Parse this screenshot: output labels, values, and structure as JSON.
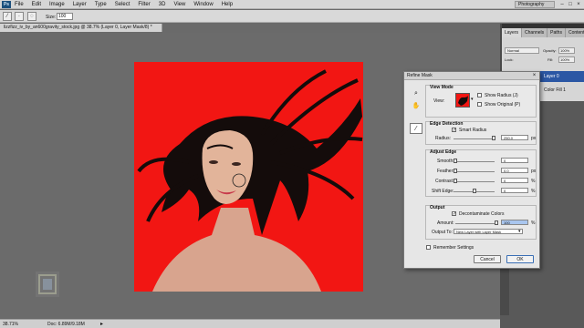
{
  "menubar": {
    "logo": "Ps",
    "items": [
      "File",
      "Edit",
      "Image",
      "Layer",
      "Type",
      "Select",
      "Filter",
      "3D",
      "View",
      "Window",
      "Help"
    ],
    "workspace": "Photography"
  },
  "options": {
    "size_label": "Size:",
    "size_value": "100"
  },
  "document": {
    "tab_title": "lizzfizz_iv_by_an600gravity_stock.jpg @ 38.7% (Layer 0, Layer Mask/8) *"
  },
  "status": {
    "zoom": "38.71%",
    "doc": "Doc: 6.89M/9.18M"
  },
  "panels": {
    "tabs": [
      "Layers",
      "Channels",
      "Paths",
      "Contents"
    ],
    "blend_mode": "Normal",
    "opacity_label": "Opacity:",
    "opacity_value": "100%",
    "lock_label": "Lock:",
    "fill_label": "Fill:",
    "fill_value": "100%",
    "layers": [
      {
        "name": "Layer 0"
      },
      {
        "name": "Color Fill 1"
      }
    ]
  },
  "dialog": {
    "title": "Refine Mask",
    "view_mode": {
      "title": "View Mode",
      "view_label": "View:",
      "show_radius": "Show Radius (J)",
      "show_original": "Show Original (P)"
    },
    "edge_detection": {
      "title": "Edge Detection",
      "smart_radius": "Smart Radius",
      "radius_label": "Radius:",
      "radius_value": "250.0",
      "radius_unit": "px"
    },
    "adjust_edge": {
      "title": "Adjust Edge",
      "smooth_label": "Smooth:",
      "smooth_value": "0",
      "feather_label": "Feather:",
      "feather_value": "0.0",
      "feather_unit": "px",
      "contrast_label": "Contrast:",
      "contrast_value": "0",
      "contrast_unit": "%",
      "shift_label": "Shift Edge:",
      "shift_value": "0",
      "shift_unit": "%"
    },
    "output": {
      "title": "Output",
      "decontaminate": "Decontaminate Colors",
      "amount_label": "Amount:",
      "amount_value": "100",
      "amount_unit": "%",
      "output_to_label": "Output To:",
      "output_to_value": "New Layer with Layer Mask"
    },
    "remember": "Remember Settings",
    "cancel": "Cancel",
    "ok": "OK"
  }
}
